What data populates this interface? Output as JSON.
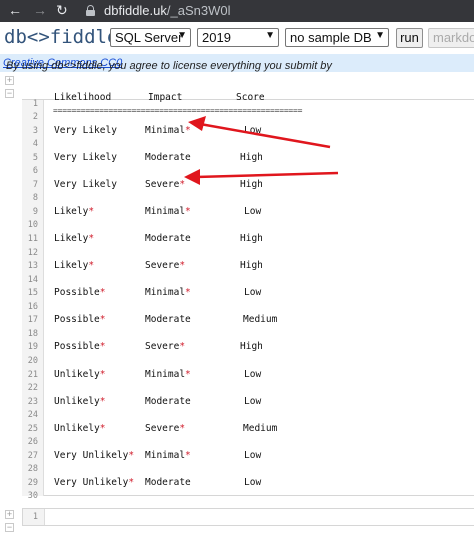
{
  "browser": {
    "url_host": "dbfiddle.uk",
    "url_path": "/_aSn3W0l",
    "back_glyph": "←",
    "forward_glyph": "→",
    "reload_glyph": "↻"
  },
  "toolbar": {
    "logo": "db<>fiddle",
    "db_engine": "SQL Server",
    "version": "2019",
    "sample_db": "no sample DB",
    "run_label": "run",
    "markdown_label": "markdo"
  },
  "license": {
    "text": "By using db<>fiddle, you agree to license everything you submit by ",
    "link": "Creative Commons CC0",
    "suffix": "."
  },
  "panel_controls": {
    "expand": "+",
    "collapse": "−"
  },
  "editor": {
    "header": {
      "likelihood": "Likelihood",
      "impact": "Impact",
      "score": "Score"
    },
    "separator": "======================================================",
    "rows": [
      {
        "line": "3",
        "likelihood": "Very Likely",
        "lk_marker": "",
        "impact": "Minimal",
        "im_marker": "*",
        "score": "Low"
      },
      {
        "line": "5",
        "likelihood": "Very Likely",
        "lk_marker": "",
        "impact": "Moderate",
        "im_marker": "",
        "score": "High"
      },
      {
        "line": "7",
        "likelihood": "Very Likely",
        "lk_marker": "",
        "impact": "Severe",
        "im_marker": "*",
        "score": "High"
      },
      {
        "line": "9",
        "likelihood": "Likely",
        "lk_marker": "*",
        "impact": "Minimal",
        "im_marker": "*",
        "score": "Low"
      },
      {
        "line": "11",
        "likelihood": "Likely",
        "lk_marker": "*",
        "impact": "Moderate",
        "im_marker": "",
        "score": "High"
      },
      {
        "line": "13",
        "likelihood": "Likely",
        "lk_marker": "*",
        "impact": "Severe",
        "im_marker": "*",
        "score": "High"
      },
      {
        "line": "15",
        "likelihood": "Possible",
        "lk_marker": "*",
        "impact": "Minimal",
        "im_marker": "*",
        "score": "Low"
      },
      {
        "line": "17",
        "likelihood": "Possible",
        "lk_marker": "*",
        "impact": "Moderate",
        "im_marker": "",
        "score": "Medium"
      },
      {
        "line": "19",
        "likelihood": "Possible",
        "lk_marker": "*",
        "impact": "Severe",
        "im_marker": "*",
        "score": "High"
      },
      {
        "line": "21",
        "likelihood": "Unlikely",
        "lk_marker": "*",
        "impact": "Minimal",
        "im_marker": "*",
        "score": "Low"
      },
      {
        "line": "23",
        "likelihood": "Unlikely",
        "lk_marker": "*",
        "impact": "Moderate",
        "im_marker": "",
        "score": "Low"
      },
      {
        "line": "25",
        "likelihood": "Unlikely",
        "lk_marker": "*",
        "impact": "Severe",
        "im_marker": "*",
        "score": "Medium"
      },
      {
        "line": "27",
        "likelihood": "Very Unlikely",
        "lk_marker": "*",
        "impact": "Minimal",
        "im_marker": "*",
        "score": "Low"
      },
      {
        "line": "29",
        "likelihood": "Very Unlikely",
        "lk_marker": "*",
        "impact": "Moderate",
        "im_marker": "",
        "score": "Low"
      }
    ],
    "line_numbers": [
      "1",
      "2",
      "4",
      "6",
      "8",
      "10",
      "12",
      "14",
      "16",
      "18",
      "20",
      "22",
      "24",
      "26",
      "28",
      "30"
    ]
  },
  "editor2": {
    "line": "1"
  },
  "colors": {
    "marker": "#d01c2b",
    "arrow": "#e0161d",
    "logo": "#33547b",
    "license_bg": "#dcecfb",
    "link": "#1a4fd6"
  }
}
